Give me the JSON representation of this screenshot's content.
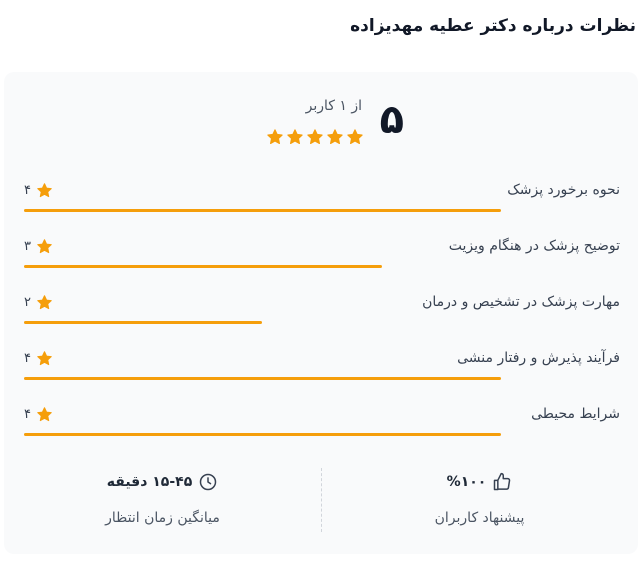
{
  "title": "نظرات درباره دکتر عطیه مهدیزاده",
  "summary": {
    "score": "۵",
    "caption": "از ۱ کاربر",
    "stars_filled": 5,
    "stars_total": 5
  },
  "ratings": [
    {
      "label": "نحوه برخورد پزشک",
      "score": "۴",
      "fraction": 0.8
    },
    {
      "label": "توضیح پزشک در هنگام ویزیت",
      "score": "۳",
      "fraction": 0.6
    },
    {
      "label": "مهارت پزشک در تشخیص و درمان",
      "score": "۲",
      "fraction": 0.4
    },
    {
      "label": "فرآیند پذیرش و رفتار منشی",
      "score": "۴",
      "fraction": 0.8
    },
    {
      "label": "شرایط محیطی",
      "score": "۴",
      "fraction": 0.8
    }
  ],
  "stats": {
    "recommend": {
      "value": "%۱۰۰",
      "caption": "پیشنهاد کاربران",
      "icon": "thumbs-up-icon"
    },
    "wait_time": {
      "value": "۱۵-۴۵ دقیقه",
      "caption": "میانگین زمان انتظار",
      "icon": "clock-icon"
    }
  },
  "colors": {
    "star": "#f59e0b",
    "bar": "#f59e0b",
    "card_bg": "#f9fafb"
  }
}
